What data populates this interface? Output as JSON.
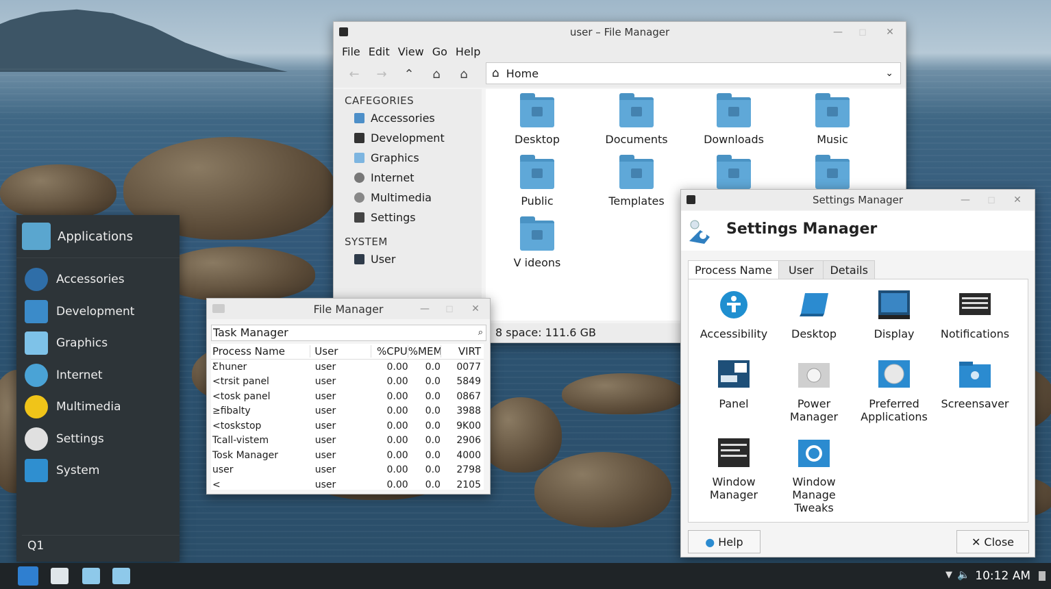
{
  "file_manager": {
    "title": "user – File Manager",
    "menu": [
      "File",
      "Edit",
      "View",
      "Go",
      "Help"
    ],
    "location": "Home",
    "sidebar": {
      "categories_header": "CAFEGORIES",
      "categories": [
        "Accessories",
        "Development",
        "Graphics",
        "Internet",
        "Multimedia",
        "Settings"
      ],
      "system_header": "SYSTEM",
      "system": [
        "User"
      ]
    },
    "folders": [
      "Desktop",
      "Documents",
      "Downloads",
      "Music",
      "Public",
      "Templates",
      "V ideons"
    ],
    "status": "8 space: 111.6 GB"
  },
  "task_manager": {
    "title": "File Manager",
    "search_value": "Task Manager",
    "columns": [
      "Process Name",
      "User",
      "%CPU",
      "%MEM",
      "VIRT"
    ],
    "rows": [
      [
        "Ƹhuner",
        "user",
        "0.00",
        "0.0",
        "0077"
      ],
      [
        "<trsit panel",
        "user",
        "0.00",
        "0.0",
        "5849"
      ],
      [
        "<tosk panel",
        "user",
        "0.00",
        "0.0",
        "0867"
      ],
      [
        "≥fibalty",
        "user",
        "0.00",
        "0.0",
        "3988"
      ],
      [
        "<toskstop",
        "user",
        "0.00",
        "0.0",
        "9K00"
      ],
      [
        "Tcall-vistem",
        "user",
        "0.00",
        "0.0",
        "2906"
      ],
      [
        "Tosk Manager",
        "user",
        "0.00",
        "0.0",
        "4000"
      ],
      [
        "user",
        "user",
        "0.00",
        "0.0",
        "2798"
      ],
      [
        "<",
        "user",
        "0.00",
        "0.0",
        "2105"
      ]
    ]
  },
  "settings_manager": {
    "title": "Settings Manager",
    "heading": "Settings Manager",
    "tabs": [
      "Process Name",
      "User",
      "Details"
    ],
    "items": [
      "Accessibility",
      "Desktop",
      "Display",
      "Notifications",
      "Panel",
      "Power Manager",
      "Preferred Applications",
      "Screensaver",
      "Window Manager",
      "Window Manage Tweaks"
    ],
    "help_label": "Help",
    "close_label": "Close"
  },
  "app_menu": {
    "title": "Applications",
    "items": [
      "Accessories",
      "Development",
      "Graphics",
      "Internet",
      "Multimedia",
      "Settings",
      "System"
    ],
    "search_value": "Q1"
  },
  "panel": {
    "clock": "10:12 AM"
  }
}
